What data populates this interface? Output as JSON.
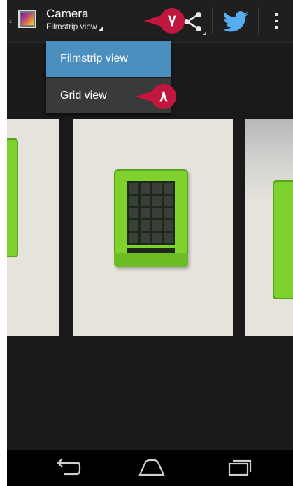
{
  "action_bar": {
    "title": "Camera",
    "subtitle": "Filmstrip view",
    "up_caret": "‹"
  },
  "dropdown": {
    "items": [
      {
        "label": "Filmstrip view",
        "selected": true
      },
      {
        "label": "Grid view",
        "selected": false
      }
    ]
  },
  "annotations": [
    "٧",
    "٨"
  ],
  "icons": {
    "app": "camera-gallery-icon",
    "share": "share-icon",
    "twitter": "twitter-icon",
    "overflow": "overflow-menu-icon",
    "back": "back-icon",
    "home": "home-icon",
    "recents": "recent-apps-icon"
  },
  "colors": {
    "selected_item": "#4b8fbf",
    "callout": "#c1163d",
    "twitter": "#55acee",
    "board": "#7fd12e"
  }
}
